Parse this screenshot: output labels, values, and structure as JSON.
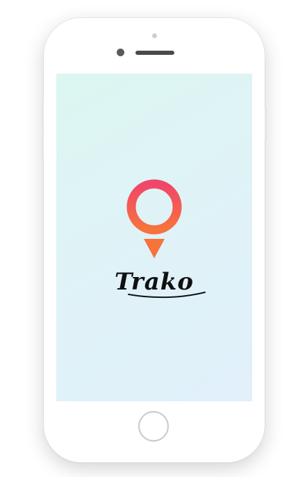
{
  "app": {
    "name": "Trako"
  },
  "screen": {
    "background_gradient": [
      "#dcf6f1",
      "#e1f0fb"
    ]
  },
  "logo": {
    "icon": "map-pin-icon",
    "gradient_top": "#f0466a",
    "gradient_bottom": "#f7733c"
  },
  "device": {
    "body_color": "#ffffff",
    "home_button_icon": "home-button-ring"
  }
}
